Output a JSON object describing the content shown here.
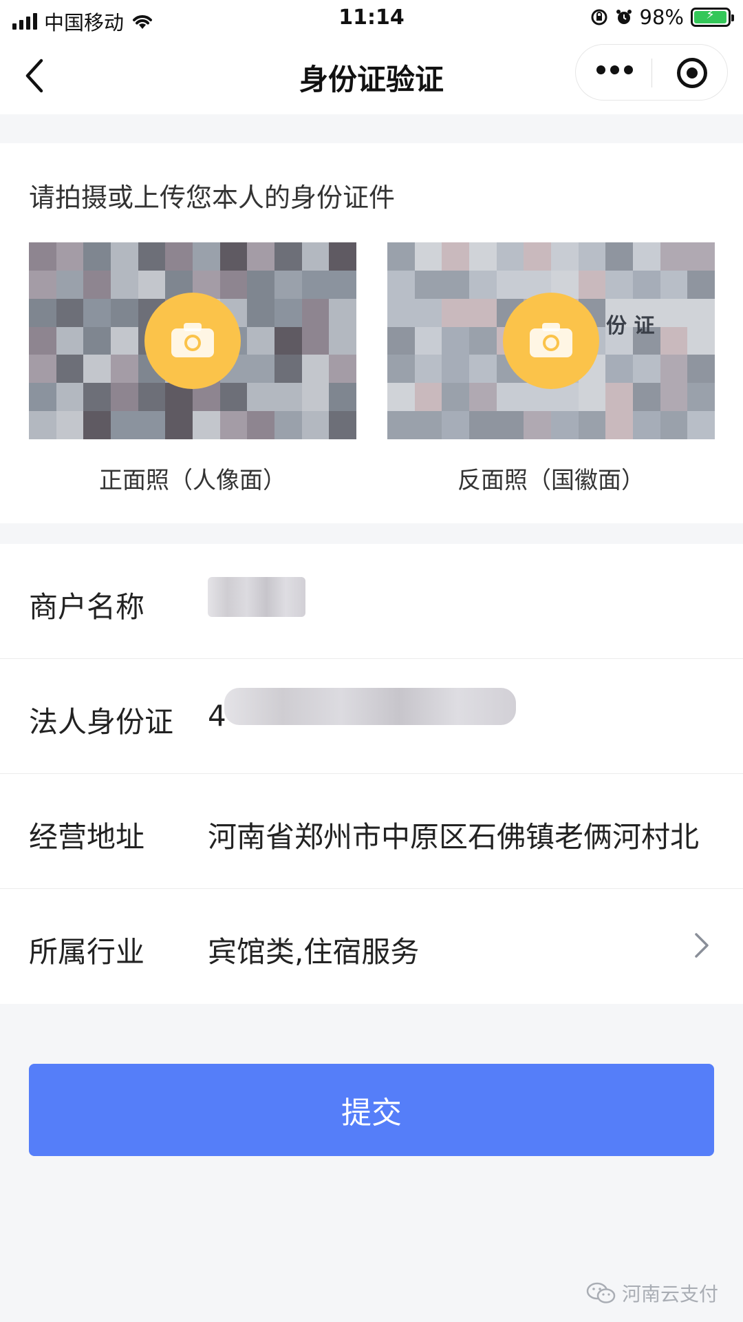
{
  "status_bar": {
    "carrier": "中国移动",
    "time": "11:14",
    "battery": "98%",
    "battery_level": 0.98,
    "icons": [
      "signal-icon",
      "wifi-icon",
      "rotation-lock-icon",
      "alarm-icon",
      "battery-charging-icon"
    ]
  },
  "nav": {
    "title": "身份证验证",
    "icons": [
      "back-arrow-icon",
      "more-dots-icon",
      "close-miniprogram-icon"
    ]
  },
  "upload": {
    "title": "请拍摄或上传您本人的身份证件",
    "front_caption": "正面照（人像面）",
    "back_caption": "反面照（国徽面）",
    "camera_icon": "camera-icon",
    "back_card_visible_text": "份 证"
  },
  "form": {
    "rows": [
      {
        "label": "商户名称",
        "value": ""
      },
      {
        "label": "法人身份证",
        "value": "4"
      },
      {
        "label": "经营地址",
        "value": "河南省郑州市中原区石佛镇老俩河村北"
      },
      {
        "label": "所属行业",
        "value": "宾馆类,住宿服务"
      }
    ],
    "chevron_icon": "chevron-right-icon"
  },
  "submit": {
    "label": "提交"
  },
  "watermark": {
    "text": "河南云支付",
    "icon": "wechat-icon"
  },
  "colors": {
    "primary_button": "#557ef9",
    "camera_badge": "#fbc34a",
    "background": "#f5f6f8",
    "battery_green": "#34c759"
  }
}
